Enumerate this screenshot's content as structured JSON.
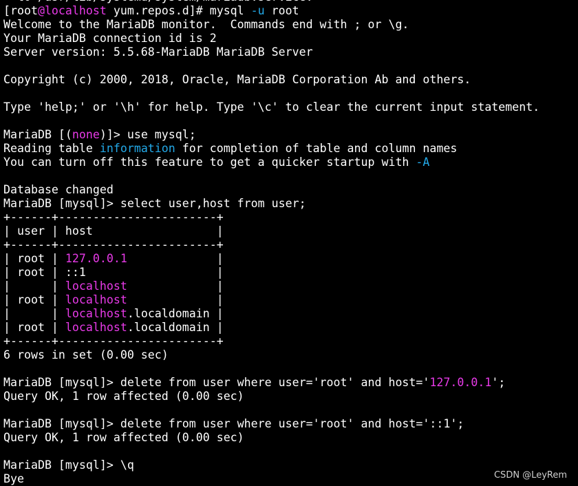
{
  "colors": {
    "background": "#000000",
    "text": "#ffffff",
    "highlight_magenta": "#e83ae8",
    "highlight_cyan": "#23a9e8"
  },
  "terminal": {
    "lines": [
      [
        {
          "t": "  to /usr/lib/systemd/system/mariadb.service."
        }
      ],
      [
        {
          "t": "[root"
        },
        {
          "t": "@localhost",
          "c": "m"
        },
        {
          "t": " yum.repos.d]# mysql "
        },
        {
          "t": "-u",
          "c": "c"
        },
        {
          "t": " root"
        }
      ],
      [
        {
          "t": "Welcome to the MariaDB monitor.  Commands end with ; or \\g."
        }
      ],
      [
        {
          "t": "Your MariaDB connection id is 2"
        }
      ],
      [
        {
          "t": "Server version: 5.5.68-MariaDB MariaDB Server"
        }
      ],
      [
        {
          "t": ""
        }
      ],
      [
        {
          "t": "Copyright (c) 2000, 2018, Oracle, MariaDB Corporation Ab and others."
        }
      ],
      [
        {
          "t": ""
        }
      ],
      [
        {
          "t": "Type 'help;' or '\\h' for help. Type '\\c' to clear the current input statement."
        }
      ],
      [
        {
          "t": ""
        }
      ],
      [
        {
          "t": "MariaDB [("
        },
        {
          "t": "none",
          "c": "m"
        },
        {
          "t": ")]> use mysql;"
        }
      ],
      [
        {
          "t": "Reading table "
        },
        {
          "t": "information",
          "c": "c"
        },
        {
          "t": " for completion of table and column names"
        }
      ],
      [
        {
          "t": "You can turn off this feature to get a quicker startup with "
        },
        {
          "t": "-A",
          "c": "c"
        }
      ],
      [
        {
          "t": ""
        }
      ],
      [
        {
          "t": "Database changed"
        }
      ],
      [
        {
          "t": "MariaDB [mysql]> select user,host from user;"
        }
      ],
      [
        {
          "t": "+------+-----------------------+"
        }
      ],
      [
        {
          "t": "| user | host                  |"
        }
      ],
      [
        {
          "t": "+------+-----------------------+"
        }
      ],
      [
        {
          "t": "| root | "
        },
        {
          "t": "127.0.0.1",
          "c": "m"
        },
        {
          "t": "             |"
        }
      ],
      [
        {
          "t": "| root | ::1                   |"
        }
      ],
      [
        {
          "t": "|      | "
        },
        {
          "t": "localhost",
          "c": "m"
        },
        {
          "t": "             |"
        }
      ],
      [
        {
          "t": "| root | "
        },
        {
          "t": "localhost",
          "c": "m"
        },
        {
          "t": "             |"
        }
      ],
      [
        {
          "t": "|      | "
        },
        {
          "t": "localhost",
          "c": "m"
        },
        {
          "t": ".localdomain |"
        }
      ],
      [
        {
          "t": "| root | "
        },
        {
          "t": "localhost",
          "c": "m"
        },
        {
          "t": ".localdomain |"
        }
      ],
      [
        {
          "t": "+------+-----------------------+"
        }
      ],
      [
        {
          "t": "6 rows in set (0.00 sec)"
        }
      ],
      [
        {
          "t": ""
        }
      ],
      [
        {
          "t": "MariaDB [mysql]> delete from user where user='root' and host='"
        },
        {
          "t": "127.0.0.1",
          "c": "m"
        },
        {
          "t": "';"
        }
      ],
      [
        {
          "t": "Query OK, 1 row affected (0.00 sec)"
        }
      ],
      [
        {
          "t": ""
        }
      ],
      [
        {
          "t": "MariaDB [mysql]> delete from user where user='root' and host='::1';"
        }
      ],
      [
        {
          "t": "Query OK, 1 row affected (0.00 sec)"
        }
      ],
      [
        {
          "t": ""
        }
      ],
      [
        {
          "t": "MariaDB [mysql]> \\q"
        }
      ],
      [
        {
          "t": "Bye"
        }
      ]
    ]
  },
  "watermark": "CSDN @LeyRem"
}
